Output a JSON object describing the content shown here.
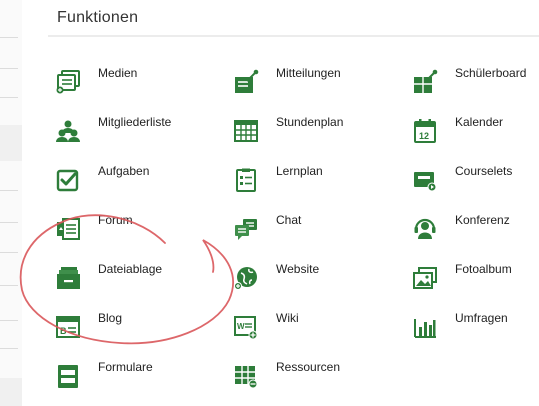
{
  "header": {
    "title": "Funktionen"
  },
  "colors": {
    "icon_green": "#2e7d3a",
    "annotation": "#d9575a"
  },
  "columns": [
    {
      "items": [
        {
          "label": "Medien",
          "icon": "media-icon"
        },
        {
          "label": "Mitgliederliste",
          "icon": "members-icon"
        },
        {
          "label": "Aufgaben",
          "icon": "tasks-check-icon"
        },
        {
          "label": "Forum",
          "icon": "forum-icon"
        },
        {
          "label": "Dateiablage",
          "icon": "file-storage-icon"
        },
        {
          "label": "Blog",
          "icon": "blog-icon"
        },
        {
          "label": "Formulare",
          "icon": "forms-icon"
        }
      ]
    },
    {
      "items": [
        {
          "label": "Mitteilungen",
          "icon": "announcements-icon"
        },
        {
          "label": "Stundenplan",
          "icon": "timetable-icon"
        },
        {
          "label": "Lernplan",
          "icon": "learning-plan-icon"
        },
        {
          "label": "Chat",
          "icon": "chat-icon"
        },
        {
          "label": "Website",
          "icon": "website-icon"
        },
        {
          "label": "Wiki",
          "icon": "wiki-icon"
        },
        {
          "label": "Ressourcen",
          "icon": "resources-icon"
        }
      ]
    },
    {
      "items": [
        {
          "label": "Schülerboard",
          "icon": "student-board-icon"
        },
        {
          "label": "Kalender",
          "icon": "calendar-icon"
        },
        {
          "label": "Courselets",
          "icon": "courselets-icon"
        },
        {
          "label": "Konferenz",
          "icon": "conference-icon"
        },
        {
          "label": "Fotoalbum",
          "icon": "photo-album-icon"
        },
        {
          "label": "Umfragen",
          "icon": "survey-icon"
        }
      ]
    }
  ],
  "calendar_day": "12"
}
